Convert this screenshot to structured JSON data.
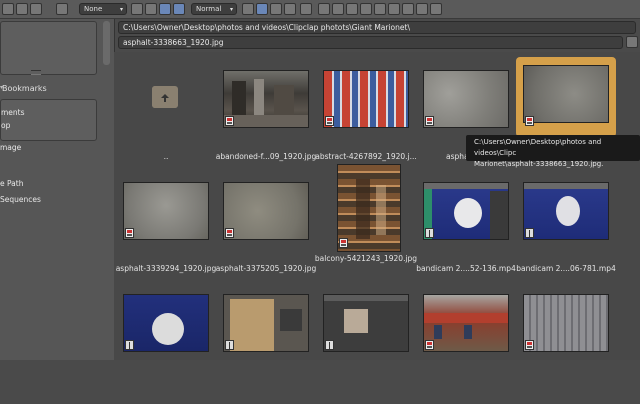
{
  "toolbar": {
    "sort_dropdown": "None",
    "display_dropdown": "Normal",
    "colors": {
      "active_button": "#6a87b8"
    }
  },
  "sidebar": {
    "bookmarks_header": "Bookmarks",
    "items": [
      "ments",
      "op"
    ],
    "section2_items": [
      "mage",
      "e Path",
      "Sequences"
    ]
  },
  "path": {
    "directory": "C:\\Users\\Owner\\Desktop\\photos and videos\\Clipclap photots\\Giant Marionet\\",
    "filename": "asphalt-3338663_1920.jpg"
  },
  "files": [
    {
      "caption": "..",
      "type": "parent-folder"
    },
    {
      "caption": "abandoned-f...09_1920.jpg",
      "type": "image",
      "thumb": "abandoned"
    },
    {
      "caption": "abstract-4267892_1920.j...",
      "type": "image",
      "thumb": "abstract"
    },
    {
      "caption": "asphalt-27",
      "type": "image",
      "thumb": "asphalt"
    },
    {
      "caption": "",
      "type": "image",
      "thumb": "asphalt2",
      "selected": true
    },
    {
      "caption": "asphalt-3339294_1920.jpg",
      "type": "image",
      "thumb": "asphalt"
    },
    {
      "caption": "asphalt-3375205_1920.jpg",
      "type": "image",
      "thumb": "asphalt3"
    },
    {
      "caption": "balcony-5421243_1920.jpg",
      "type": "image",
      "thumb": "balcony"
    },
    {
      "caption": "bandicam 2....52-136.mp4",
      "type": "movie",
      "thumb": "bandicam"
    },
    {
      "caption": "bandicam 2....06-781.mp4",
      "type": "movie",
      "thumb": "bandicam"
    },
    {
      "caption": "",
      "type": "movie",
      "thumb": "bandicam2"
    },
    {
      "caption": "",
      "type": "movie",
      "thumb": "bandicam3"
    },
    {
      "caption": "",
      "type": "movie",
      "thumb": "bandicam4"
    },
    {
      "caption": "",
      "type": "image",
      "thumb": "building"
    },
    {
      "caption": "",
      "type": "image",
      "thumb": "tower"
    }
  ],
  "tooltip": {
    "line1": "C:\\Users\\Owner\\Desktop\\photos and videos\\Clipc",
    "line2": "Marionet\\asphalt-3338663_1920.jpg."
  }
}
